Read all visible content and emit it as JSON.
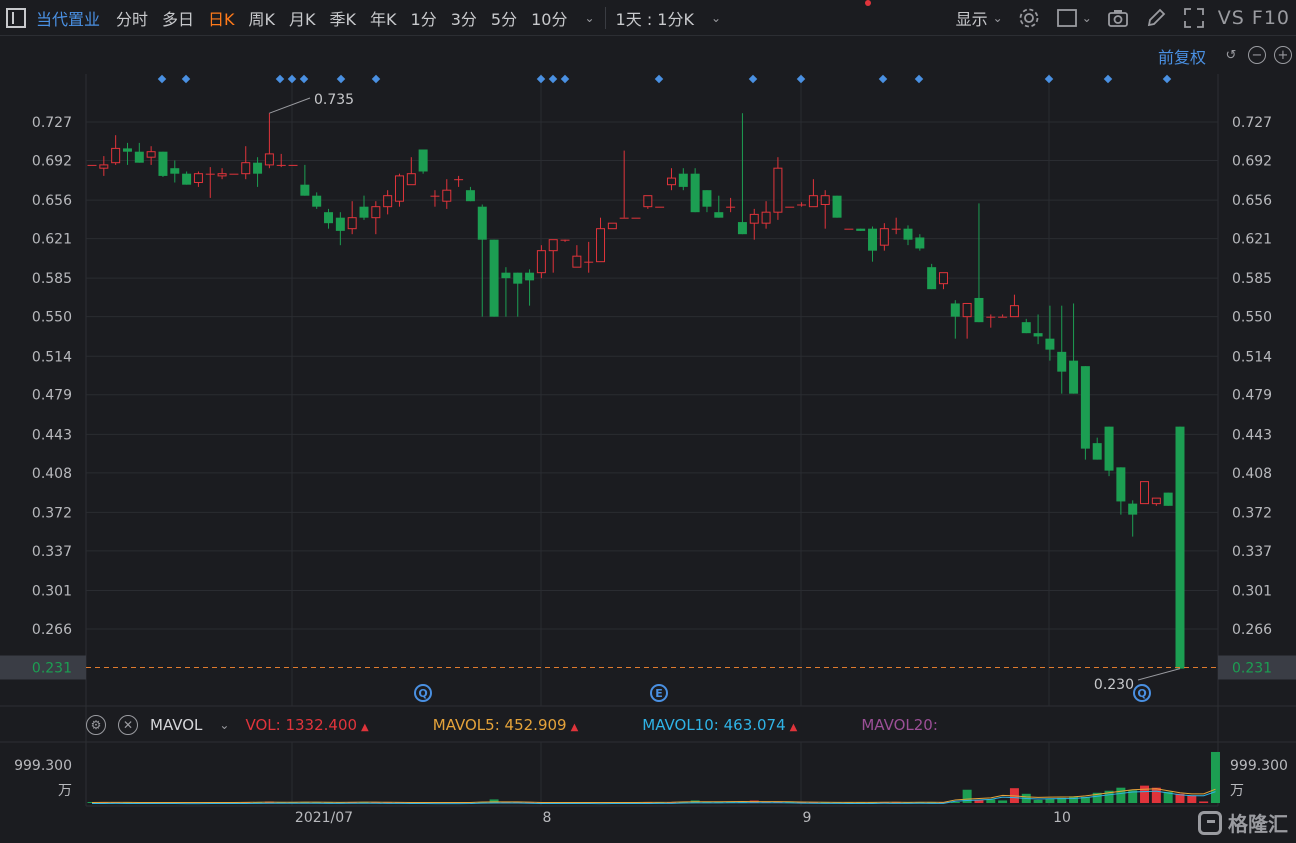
{
  "toolbar": {
    "stock_name": "当代置业",
    "periods": [
      "分时",
      "多日",
      "日K",
      "周K",
      "月K",
      "季K",
      "年K",
      "1分",
      "3分",
      "5分",
      "10分"
    ],
    "active_period": "日K",
    "combo": "1天 : 1分K",
    "display": "显示",
    "vs_f10": "VS F10",
    "icons": [
      "settings-icon",
      "rectangle-icon",
      "camera-icon",
      "pen-icon",
      "fullscreen-icon"
    ]
  },
  "adjust": "前复权",
  "colors": {
    "up": "#e0343b",
    "down": "#1c9e52",
    "grid": "#2a2c31",
    "bg": "#1b1c20",
    "accent": "#4a90e2",
    "last_price_line": "#e07b2e"
  },
  "price_axis": {
    "ticks": [
      "0.727",
      "0.692",
      "0.656",
      "0.621",
      "0.585",
      "0.550",
      "0.514",
      "0.479",
      "0.443",
      "0.408",
      "0.372",
      "0.337",
      "0.301",
      "0.266"
    ],
    "last_price": "0.231"
  },
  "annotations": {
    "high_label": "0.735",
    "low_label": "0.230"
  },
  "event_badges": [
    "Q",
    "E",
    "Q"
  ],
  "mavol": {
    "name": "MAVOL",
    "vol_label": "VOL:",
    "vol": "1332.400",
    "ma5_label": "MAVOL5:",
    "ma5": "452.909",
    "ma10_label": "MAVOL10:",
    "ma10": "463.074",
    "ma20_label": "MAVOL20:",
    "ma20": "",
    "axis_top": "999.300",
    "axis_unit": "万"
  },
  "x_labels": [
    "2021/07",
    "8",
    "9",
    "10"
  ],
  "logo": "格隆汇",
  "chart_data": {
    "type": "candlestick",
    "price_range": [
      0.23,
      0.735
    ],
    "candles": [
      [
        0.688,
        0.688,
        0.688,
        0.688
      ],
      [
        0.685,
        0.696,
        0.678,
        0.688
      ],
      [
        0.69,
        0.715,
        0.688,
        0.703
      ],
      [
        0.703,
        0.708,
        0.688,
        0.7
      ],
      [
        0.7,
        0.708,
        0.69,
        0.69
      ],
      [
        0.695,
        0.705,
        0.688,
        0.7
      ],
      [
        0.7,
        0.7,
        0.677,
        0.678
      ],
      [
        0.685,
        0.692,
        0.672,
        0.68
      ],
      [
        0.68,
        0.682,
        0.67,
        0.67
      ],
      [
        0.672,
        0.682,
        0.668,
        0.68
      ],
      [
        0.68,
        0.686,
        0.658,
        0.68
      ],
      [
        0.678,
        0.685,
        0.675,
        0.68
      ],
      [
        0.68,
        0.68,
        0.68,
        0.68
      ],
      [
        0.68,
        0.705,
        0.675,
        0.69
      ],
      [
        0.69,
        0.695,
        0.668,
        0.68
      ],
      [
        0.688,
        0.735,
        0.685,
        0.698
      ],
      [
        0.688,
        0.698,
        0.686,
        0.688
      ],
      [
        0.688,
        0.688,
        0.688,
        0.688
      ],
      [
        0.67,
        0.688,
        0.66,
        0.66
      ],
      [
        0.66,
        0.663,
        0.648,
        0.65
      ],
      [
        0.645,
        0.648,
        0.63,
        0.635
      ],
      [
        0.64,
        0.645,
        0.615,
        0.628
      ],
      [
        0.63,
        0.655,
        0.625,
        0.64
      ],
      [
        0.65,
        0.66,
        0.638,
        0.64
      ],
      [
        0.64,
        0.655,
        0.625,
        0.65
      ],
      [
        0.65,
        0.665,
        0.643,
        0.66
      ],
      [
        0.655,
        0.68,
        0.65,
        0.678
      ],
      [
        0.67,
        0.695,
        0.67,
        0.68
      ],
      [
        0.702,
        0.702,
        0.68,
        0.682
      ],
      [
        0.66,
        0.665,
        0.65,
        0.66
      ],
      [
        0.655,
        0.675,
        0.648,
        0.665
      ],
      [
        0.675,
        0.678,
        0.668,
        0.675
      ],
      [
        0.665,
        0.668,
        0.655,
        0.655
      ],
      [
        0.65,
        0.652,
        0.55,
        0.62
      ],
      [
        0.62,
        0.62,
        0.55,
        0.55
      ],
      [
        0.59,
        0.595,
        0.55,
        0.585
      ],
      [
        0.59,
        0.59,
        0.55,
        0.58
      ],
      [
        0.59,
        0.593,
        0.56,
        0.583
      ],
      [
        0.59,
        0.615,
        0.585,
        0.61
      ],
      [
        0.61,
        0.62,
        0.59,
        0.62
      ],
      [
        0.62,
        0.62,
        0.618,
        0.62
      ],
      [
        0.595,
        0.615,
        0.595,
        0.605
      ],
      [
        0.6,
        0.618,
        0.59,
        0.6
      ],
      [
        0.6,
        0.64,
        0.6,
        0.63
      ],
      [
        0.63,
        0.635,
        0.63,
        0.635
      ],
      [
        0.64,
        0.701,
        0.64,
        0.64
      ],
      [
        0.64,
        0.64,
        0.64,
        0.64
      ],
      [
        0.65,
        0.66,
        0.648,
        0.66
      ],
      [
        0.65,
        0.65,
        0.65,
        0.65
      ],
      [
        0.67,
        0.685,
        0.665,
        0.676
      ],
      [
        0.68,
        0.685,
        0.665,
        0.668
      ],
      [
        0.68,
        0.685,
        0.645,
        0.645
      ],
      [
        0.665,
        0.665,
        0.645,
        0.65
      ],
      [
        0.645,
        0.66,
        0.64,
        0.64
      ],
      [
        0.65,
        0.658,
        0.645,
        0.65
      ],
      [
        0.636,
        0.735,
        0.625,
        0.625
      ],
      [
        0.635,
        0.648,
        0.62,
        0.643
      ],
      [
        0.635,
        0.655,
        0.63,
        0.645
      ],
      [
        0.645,
        0.695,
        0.638,
        0.685
      ],
      [
        0.65,
        0.65,
        0.65,
        0.65
      ],
      [
        0.652,
        0.654,
        0.65,
        0.652
      ],
      [
        0.65,
        0.675,
        0.65,
        0.66
      ],
      [
        0.652,
        0.665,
        0.63,
        0.66
      ],
      [
        0.66,
        0.66,
        0.64,
        0.64
      ],
      [
        0.63,
        0.63,
        0.63,
        0.63
      ],
      [
        0.63,
        0.63,
        0.628,
        0.628
      ],
      [
        0.63,
        0.632,
        0.6,
        0.61
      ],
      [
        0.615,
        0.635,
        0.61,
        0.63
      ],
      [
        0.63,
        0.64,
        0.625,
        0.63
      ],
      [
        0.63,
        0.633,
        0.615,
        0.62
      ],
      [
        0.622,
        0.625,
        0.61,
        0.612
      ],
      [
        0.595,
        0.598,
        0.575,
        0.575
      ],
      [
        0.58,
        0.59,
        0.575,
        0.59
      ],
      [
        0.562,
        0.565,
        0.53,
        0.55
      ],
      [
        0.55,
        0.562,
        0.53,
        0.562
      ],
      [
        0.567,
        0.653,
        0.545,
        0.545
      ],
      [
        0.55,
        0.552,
        0.54,
        0.55
      ],
      [
        0.55,
        0.552,
        0.55,
        0.55
      ],
      [
        0.55,
        0.57,
        0.55,
        0.56
      ],
      [
        0.545,
        0.548,
        0.535,
        0.535
      ],
      [
        0.535,
        0.552,
        0.525,
        0.532
      ],
      [
        0.53,
        0.56,
        0.51,
        0.52
      ],
      [
        0.518,
        0.56,
        0.48,
        0.5
      ],
      [
        0.51,
        0.562,
        0.48,
        0.48
      ],
      [
        0.505,
        0.505,
        0.42,
        0.43
      ],
      [
        0.435,
        0.44,
        0.42,
        0.42
      ],
      [
        0.45,
        0.45,
        0.405,
        0.41
      ],
      [
        0.413,
        0.413,
        0.37,
        0.382
      ],
      [
        0.38,
        0.383,
        0.35,
        0.37
      ],
      [
        0.38,
        0.4,
        0.38,
        0.4
      ],
      [
        0.38,
        0.385,
        0.378,
        0.385
      ],
      [
        0.39,
        0.39,
        0.378,
        0.378
      ],
      [
        0.45,
        0.45,
        0.23,
        0.23
      ]
    ],
    "volume_axis_max": 999.3,
    "volumes": [
      18,
      12,
      15,
      10,
      12,
      9,
      11,
      10,
      8,
      9,
      10,
      8,
      9,
      12,
      10,
      28,
      12,
      9,
      22,
      15,
      18,
      16,
      12,
      22,
      14,
      11,
      10,
      9,
      10,
      8,
      9,
      8,
      10,
      12,
      70,
      9,
      14,
      10,
      12,
      8,
      9,
      10,
      10,
      9,
      8,
      12,
      10,
      14,
      12,
      15,
      16,
      50,
      20,
      18,
      14,
      22,
      48,
      26,
      16,
      30,
      20,
      15,
      14,
      10,
      12,
      15,
      10,
      12,
      22,
      12,
      14,
      16,
      20,
      10,
      260,
      60,
      70,
      50,
      290,
      180,
      60,
      80,
      100,
      130,
      120,
      200,
      240,
      300,
      250,
      340,
      300,
      220,
      180,
      150,
      30,
      1000
    ],
    "volume_up": [
      false,
      true,
      true,
      false,
      false,
      false,
      false,
      false,
      true,
      true,
      true,
      false,
      false,
      true,
      false,
      true,
      false,
      false,
      false,
      false,
      false,
      false,
      true,
      false,
      true,
      true,
      true,
      true,
      false,
      false,
      true,
      false,
      false,
      false,
      false,
      true,
      true,
      true,
      true,
      true,
      false,
      false,
      true,
      true,
      true,
      true,
      false,
      true,
      false,
      true,
      false,
      false,
      false,
      false,
      false,
      false,
      true,
      true,
      true,
      false,
      true,
      true,
      false,
      false,
      false,
      false,
      false,
      true,
      true,
      false,
      false,
      false,
      true,
      false,
      false,
      true,
      false,
      false,
      true,
      false,
      false,
      false,
      false,
      false,
      false,
      false,
      false,
      false,
      false,
      true,
      true,
      false,
      true,
      true,
      true,
      false
    ],
    "ma_vol": [
      10,
      12,
      13,
      12,
      11,
      10,
      10,
      10,
      9,
      9,
      10,
      10,
      10,
      12,
      14,
      16,
      15,
      15,
      16,
      17,
      14,
      13,
      15,
      17,
      16,
      14,
      13,
      11,
      10,
      9,
      9,
      9,
      10,
      20,
      22,
      22,
      22,
      16,
      10,
      10,
      10,
      10,
      10,
      9,
      10,
      10,
      11,
      12,
      13,
      14,
      22,
      24,
      24,
      25,
      26,
      30,
      26,
      26,
      28,
      24,
      19,
      16,
      14,
      13,
      12,
      12,
      12,
      15,
      14,
      13,
      15,
      14,
      13,
      60,
      75,
      88,
      100,
      150,
      140,
      120,
      110,
      115,
      118,
      120,
      140,
      170,
      200,
      230,
      260,
      270,
      280,
      240,
      200,
      180,
      180,
      270
    ]
  }
}
